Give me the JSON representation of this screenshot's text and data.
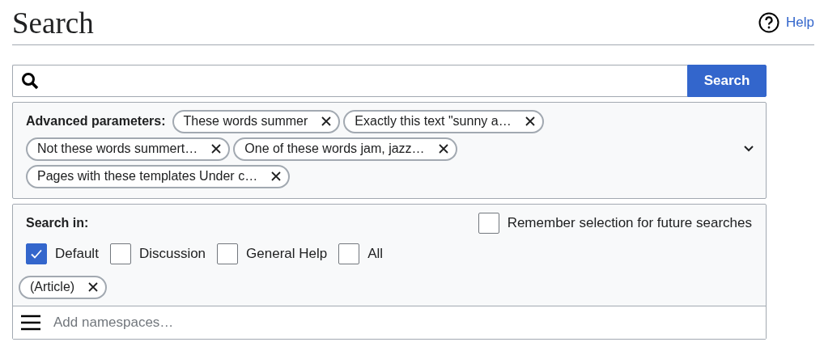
{
  "title": "Search",
  "help": {
    "label": "Help"
  },
  "search": {
    "button": "Search"
  },
  "advanced": {
    "label": "Advanced parameters:",
    "expanded": false,
    "chips": [
      {
        "label": "These words summer"
      },
      {
        "label": "Exactly this text \"sunny a…"
      },
      {
        "label": "Not these words summert…"
      },
      {
        "label": "One of these words jam, jazz…"
      },
      {
        "label": "Pages with these templates Under c…"
      }
    ]
  },
  "search_in": {
    "label": "Search in:",
    "remember": {
      "label": "Remember selection for future searches",
      "checked": false
    },
    "options": [
      {
        "label": "Default",
        "checked": true
      },
      {
        "label": "Discussion",
        "checked": false
      },
      {
        "label": "General Help",
        "checked": false
      },
      {
        "label": "All",
        "checked": false
      }
    ],
    "chips": [
      {
        "label": "(Article)"
      }
    ],
    "add_placeholder": "Add namespaces…"
  }
}
